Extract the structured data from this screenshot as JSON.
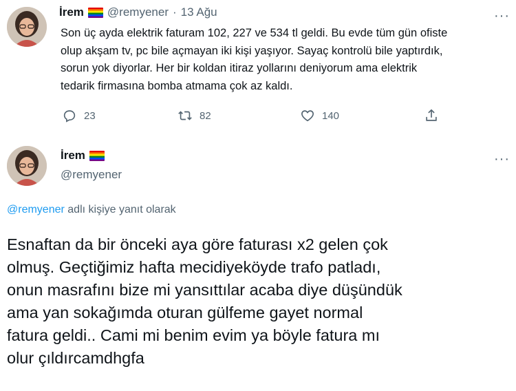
{
  "tweet1": {
    "name": "İrem",
    "handle": "@remyener",
    "separator": "·",
    "date": "13 Ağu",
    "text": "Son üç ayda elektrik faturam 102, 227 ve 534 tl geldi. Bu evde tüm gün ofiste\nolup akşam tv, pc bile açmayan iki kişi yaşıyor. Sayaç kontrolü bile yaptırdık,\nsorun yok diyorlar. Her bir koldan itiraz yollarını deniyorum ama elektrik\ntedarik firmasına bomba atmama çok az kaldı.",
    "more_label": "···",
    "actions": {
      "reply_count": "23",
      "retweet_count": "82",
      "like_count": "140"
    }
  },
  "tweet2": {
    "name": "İrem",
    "handle": "@remyener",
    "more_label": "···",
    "reply_mention": "@remyener",
    "reply_suffix": " adlı kişiye yanıt olarak",
    "text": "Esnaftan da bir önceki aya göre faturası x2 gelen çok\nolmuş. Geçtiğimiz hafta mecidiyeköyde trafo patladı,\nonun masrafını bize mi yansıttılar acaba diye düşündük\nama yan sokağımda oturan gülfeme gayet normal\nfatura geldi.. Cami mi benim evim ya böyle fatura mı\nolur çıldırcamdhgfa"
  },
  "colors": {
    "text": "#0f1419",
    "muted": "#536471",
    "link": "#1d9bf0"
  },
  "icons": [
    "avatar",
    "rainbow-flag-icon",
    "more-icon",
    "reply-icon",
    "retweet-icon",
    "like-icon",
    "share-icon"
  ]
}
